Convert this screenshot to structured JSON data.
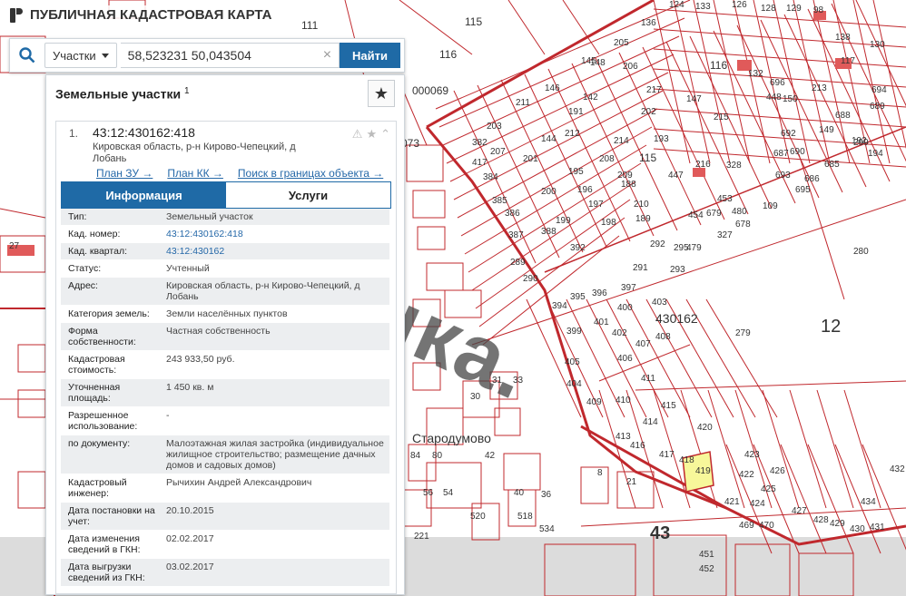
{
  "app": {
    "title": "ПУБЛИЧНАЯ КАДАСТРОВАЯ КАРТА",
    "logo_icon": "pkk-logo-icon"
  },
  "search": {
    "type_label": "Участки",
    "query": "58,523231 50,043504",
    "find_label": "Найти",
    "clear_glyph": "×"
  },
  "panel": {
    "title": "Земельные участки",
    "count_sup": "1",
    "star_glyph": "★"
  },
  "card": {
    "index": "1.",
    "cad_number": "43:12:430162:418",
    "address": "Кировская область, р-н Кирово-Чепецкий, д Лобань",
    "links": {
      "plan_zu": "План ЗУ →",
      "plan_kk": "План КК →",
      "search_in": "Поиск в границах объекта →"
    },
    "tabs": {
      "info": "Информация",
      "services": "Услуги"
    },
    "rows": [
      {
        "k": "Тип:",
        "v": "Земельный участок"
      },
      {
        "k": "Кад. номер:",
        "v": "43:12:430162:418"
      },
      {
        "k": "Кад. квартал:",
        "v": "43:12:430162"
      },
      {
        "k": "Статус:",
        "v": "Учтенный"
      },
      {
        "k": "Адрес:",
        "v": "Кировская область, р-н Кирово-Чепецкий, д Лобань"
      },
      {
        "k": "Категория земель:",
        "v": "Земли населённых пунктов"
      },
      {
        "k": "Форма собственности:",
        "v": "Частная собственность"
      },
      {
        "k": "Кадастровая стоимость:",
        "v": "243 933,50 руб."
      },
      {
        "k": "Уточненная площадь:",
        "v": "1 450 кв. м"
      },
      {
        "k": "Разрешенное использование:",
        "v": "-"
      },
      {
        "k": "по документу:",
        "v": "Малоэтажная жилая застройка (индивидуальное жилищное строительство; размещение дачных домов и садовых домов)"
      },
      {
        "k": "Кадастровый инженер:",
        "v": "Рычихин Андрей Александрович"
      },
      {
        "k": "Дата постановки на учет:",
        "v": "20.10.2015"
      },
      {
        "k": "Дата изменения сведений в ГКН:",
        "v": "02.02.2017"
      },
      {
        "k": "Дата выгрузки сведений из ГКН:",
        "v": "03.02.2017"
      }
    ]
  },
  "map": {
    "labels": [
      "111",
      "115",
      "116",
      "000069",
      "073",
      "27",
      "30",
      "31",
      "33",
      "Стародумово",
      "84",
      "80",
      "42",
      "56",
      "54",
      "40",
      "520",
      "518",
      "36",
      "534",
      "430162",
      "12",
      "279",
      "280",
      "43",
      "124",
      "133",
      "126",
      "128",
      "129",
      "98",
      "138",
      "130",
      "136",
      "117",
      "213",
      "150",
      "145",
      "205",
      "206",
      "146",
      "191",
      "217",
      "211",
      "212",
      "214",
      "148",
      "202",
      "193",
      "207",
      "144",
      "142",
      "215",
      "147",
      "115",
      "116",
      "132",
      "696",
      "694",
      "689",
      "688",
      "692",
      "690",
      "685",
      "686",
      "687",
      "693",
      "695",
      "299",
      "109",
      "328",
      "454",
      "453",
      "480",
      "678",
      "479",
      "327",
      "679",
      "292",
      "293",
      "295",
      "291",
      "388",
      "387",
      "289",
      "290",
      "386",
      "385",
      "384",
      "417",
      "382",
      "203",
      "199",
      "392",
      "394",
      "395",
      "396",
      "397",
      "400",
      "401",
      "402",
      "403",
      "399",
      "404",
      "405",
      "406",
      "407",
      "408",
      "409",
      "410",
      "411",
      "413",
      "414",
      "415",
      "416",
      "417",
      "418",
      "419",
      "420",
      "421",
      "422",
      "423",
      "424",
      "425",
      "426",
      "427",
      "428",
      "429",
      "430",
      "431",
      "432",
      "434",
      "451",
      "452",
      "8",
      "21",
      "469",
      "470",
      "195",
      "196",
      "197",
      "198",
      "208",
      "209",
      "210",
      "200",
      "201",
      "188",
      "189",
      "216",
      "447",
      "448",
      "149",
      "192",
      "194",
      "218",
      "219",
      "220",
      "221"
    ],
    "highlight_label": "418",
    "watermark": "точка."
  },
  "colors": {
    "accent": "#1f6aa6",
    "parcel_red": "#c0282d",
    "highlight": "#f7f79a"
  }
}
